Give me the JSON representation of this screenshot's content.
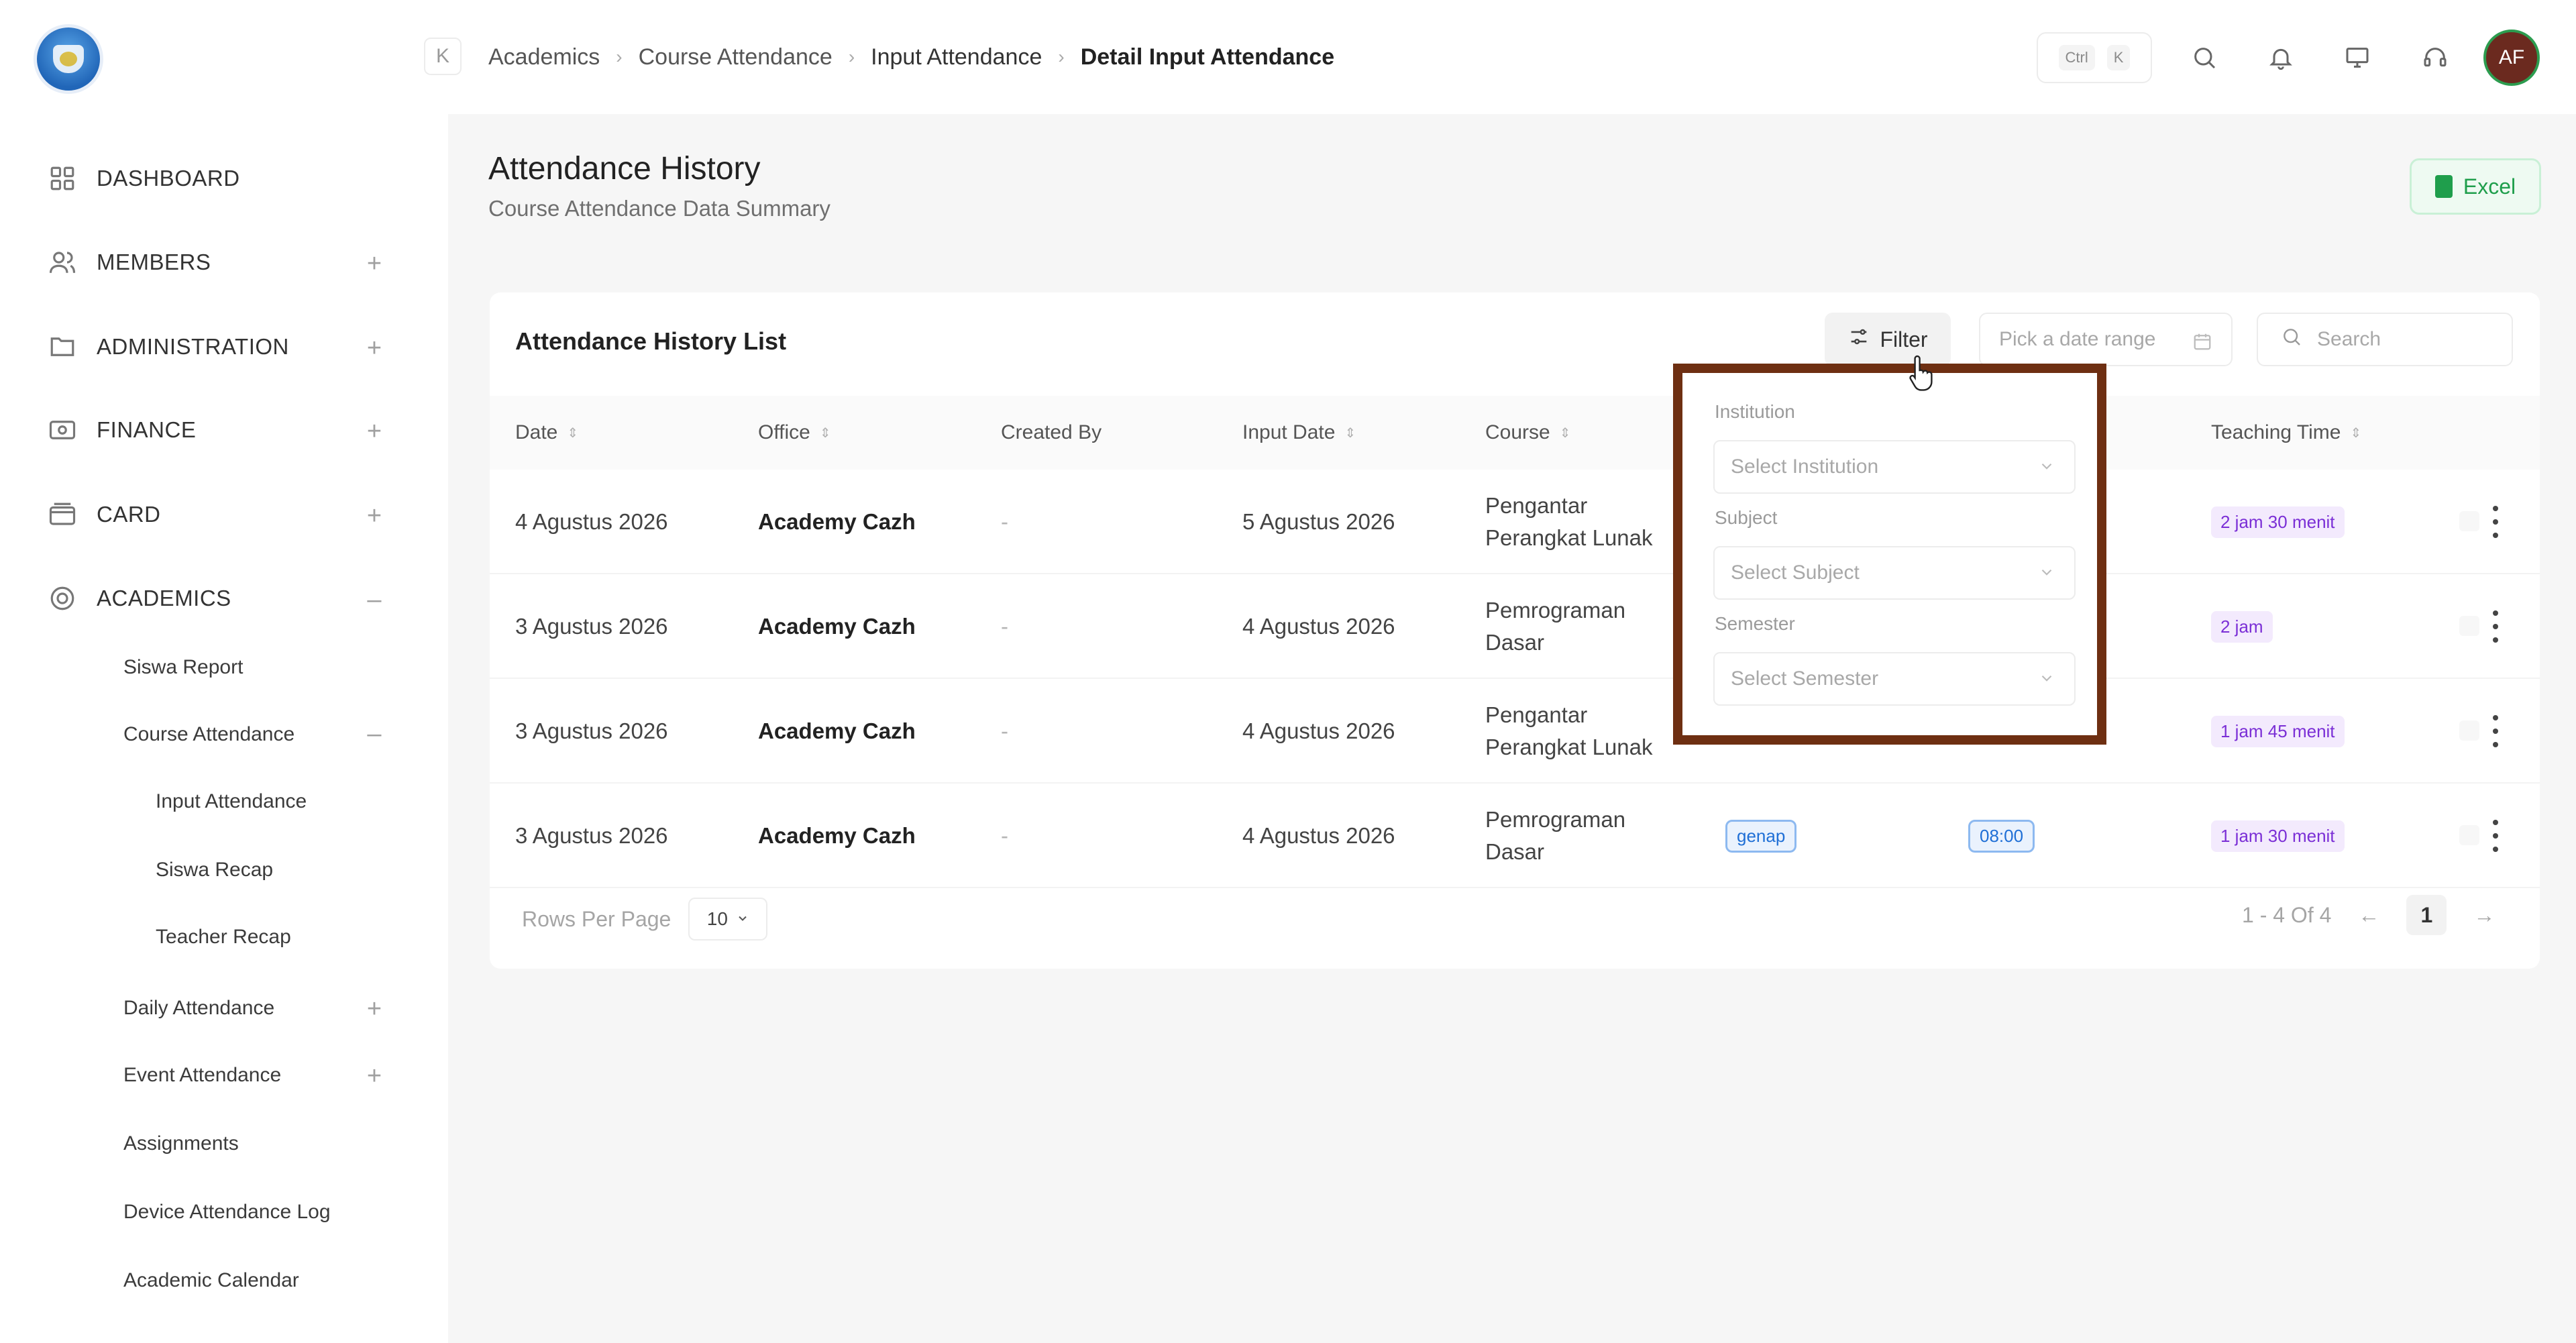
{
  "sidebar": {
    "main_items": [
      {
        "label": "DASHBOARD",
        "icon": "grid-icon",
        "toggle": ""
      },
      {
        "label": "MEMBERS",
        "icon": "users-icon",
        "toggle": "+"
      },
      {
        "label": "ADMINISTRATION",
        "icon": "folder-icon",
        "toggle": "+"
      },
      {
        "label": "FINANCE",
        "icon": "money-icon",
        "toggle": "+"
      },
      {
        "label": "CARD",
        "icon": "card-icon",
        "toggle": "+"
      },
      {
        "label": "ACADEMICS",
        "icon": "academics-icon",
        "toggle": "–"
      }
    ],
    "academics_children": [
      {
        "label": "Siswa Report",
        "toggle": ""
      },
      {
        "label": "Course Attendance",
        "toggle": "–"
      },
      {
        "label": "Daily Attendance",
        "toggle": "+"
      },
      {
        "label": "Event Attendance",
        "toggle": "+"
      },
      {
        "label": "Assignments",
        "toggle": ""
      },
      {
        "label": "Device Attendance Log",
        "toggle": ""
      },
      {
        "label": "Academic Calendar",
        "toggle": ""
      }
    ],
    "course_attendance_children": [
      {
        "label": "Input Attendance"
      },
      {
        "label": "Siswa Recap"
      },
      {
        "label": "Teacher Recap"
      }
    ]
  },
  "topbar": {
    "collapse_icon": "K",
    "breadcrumb": [
      "Academics",
      "Course Attendance",
      "Input Attendance",
      "Detail Input Attendance"
    ],
    "shortcut": {
      "ctrl": "Ctrl",
      "key": "K"
    },
    "avatar_initials": "AF"
  },
  "page": {
    "title": "Attendance History",
    "subtitle": "Course Attendance Data Summary",
    "export_label": "Excel"
  },
  "card": {
    "title": "Attendance History List",
    "filter_label": "Filter",
    "date_placeholder": "Pick a date range",
    "search_placeholder": "Search"
  },
  "table": {
    "columns": [
      {
        "label": "Date",
        "sortable": true
      },
      {
        "label": "Office",
        "sortable": true
      },
      {
        "label": "Created By",
        "sortable": false
      },
      {
        "label": "Input Date",
        "sortable": true
      },
      {
        "label": "Course",
        "sortable": true
      },
      {
        "label": "Teaching Time",
        "sortable": true
      }
    ],
    "rows": [
      {
        "date": "4 Agustus 2026",
        "office": "Academy Cazh",
        "created_by": "-",
        "input_date": "5 Agustus 2026",
        "course_1": "Pengantar",
        "course_2": "Perangkat Lunak",
        "semester": "",
        "time": "",
        "teaching_time": "2 jam 30 menit"
      },
      {
        "date": "3 Agustus 2026",
        "office": "Academy Cazh",
        "created_by": "-",
        "input_date": "4 Agustus 2026",
        "course_1": "Pemrograman",
        "course_2": "Dasar",
        "semester": "",
        "time": "",
        "teaching_time": "2 jam"
      },
      {
        "date": "3 Agustus 2026",
        "office": "Academy Cazh",
        "created_by": "-",
        "input_date": "4 Agustus 2026",
        "course_1": "Pengantar",
        "course_2": "Perangkat Lunak",
        "semester": "",
        "time": "",
        "teaching_time": "1 jam 45 menit"
      },
      {
        "date": "3 Agustus 2026",
        "office": "Academy Cazh",
        "created_by": "-",
        "input_date": "4 Agustus 2026",
        "course_1": "Pemrograman",
        "course_2": "Dasar",
        "semester": "genap",
        "time": "08:00",
        "teaching_time": "1 jam 30 menit"
      }
    ]
  },
  "footer": {
    "rows_per_page_label": "Rows Per Page",
    "rows_per_page_value": "10",
    "range_text": "1 - 4 Of 4",
    "prev": "←",
    "current_page": "1",
    "next": "→"
  },
  "filter_popup": {
    "institution_label": "Institution",
    "institution_placeholder": "Select Institution",
    "subject_label": "Subject",
    "subject_placeholder": "Select Subject",
    "semester_label": "Semester",
    "semester_placeholder": "Select Semester"
  },
  "colors": {
    "highlight_border": "#6e2f12",
    "excel_green": "#1f9e4c",
    "badge_purple": "#7b2fd6",
    "badge_blue": "#1f6fd6"
  }
}
